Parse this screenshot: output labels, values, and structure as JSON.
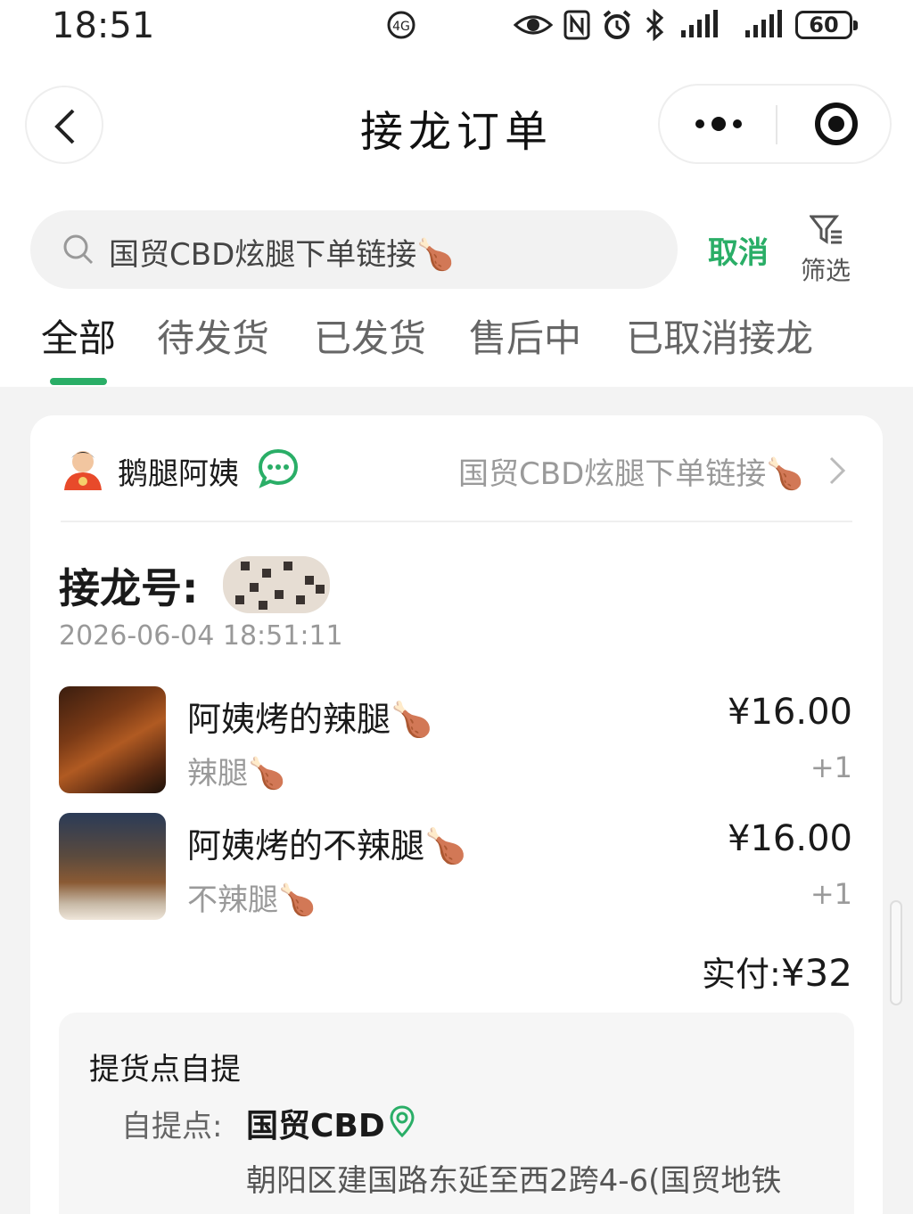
{
  "status_bar": {
    "time": "18:51",
    "battery": "60"
  },
  "nav": {
    "title": "接龙订单"
  },
  "search": {
    "query": "国贸CBD炫腿下单链接🍗",
    "cancel_label": "取消",
    "filter_label": "筛选"
  },
  "tabs": [
    {
      "label": "全部",
      "active": true
    },
    {
      "label": "待发货",
      "active": false
    },
    {
      "label": "已发货",
      "active": false
    },
    {
      "label": "售后中",
      "active": false
    },
    {
      "label": "已取消接龙",
      "active": false
    }
  ],
  "order": {
    "seller_name": "鹅腿阿姨",
    "group_name": "国贸CBD炫腿下单链接🍗",
    "order_no_label": "接龙号:",
    "time": "2026-06-04 18:51:11",
    "items": [
      {
        "name": "阿姨烤的辣腿🍗",
        "spec": "辣腿🍗",
        "price": "¥16.00",
        "qty": "+1"
      },
      {
        "name": "阿姨烤的不辣腿🍗",
        "spec": "不辣腿🍗",
        "price": "¥16.00",
        "qty": "+1"
      }
    ],
    "paid_label": "实付:",
    "paid_amount": "¥32",
    "pickup": {
      "title": "提货点自提",
      "point_label": "自提点:",
      "point_name": "国贸CBD",
      "address": "朝阳区建国路东延至西2跨4-6(国贸地铁"
    }
  },
  "colors": {
    "accent": "#2aae67",
    "background": "#f3f3f3",
    "card": "#ffffff"
  },
  "icons": [
    "back-icon",
    "more-icon",
    "close-miniprogram-icon",
    "search-icon",
    "filter-icon",
    "chat-icon",
    "chevron-right-icon",
    "location-icon"
  ]
}
